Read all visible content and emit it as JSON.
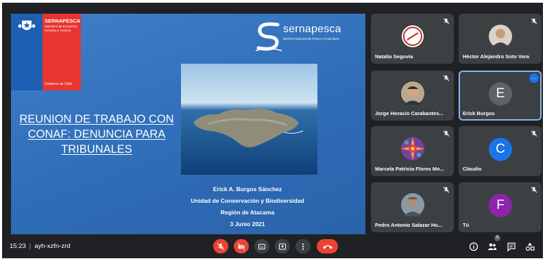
{
  "slide": {
    "gov_name": "SERNAPESCA",
    "gov_ministry": "Ministerio de Economía, Fomento y Turismo",
    "gov_footer": "Gobierno de Chile",
    "logo_name": "sernapesca",
    "logo_sub": "Servicio Nacional de Pesca y Acuicultura",
    "title": "REUNION DE TRABAJO CON CONAF: DENUNCIA PARA TRIBUNALES",
    "credit_lines": [
      "Erick A. Burgos Sánchez",
      "Unidad de Conservación  y Biodiversidad",
      "Región de Atacama",
      "3 Junio  2021"
    ]
  },
  "participants": [
    {
      "name": "Natalia Segovia",
      "avatar": "logo-avatar",
      "muted": true
    },
    {
      "name": "Héctor Alejandro Soto Vera",
      "avatar": "photo-avatar",
      "muted": true
    },
    {
      "name": "Jorge Horacio Carabantes...",
      "avatar": "photo-avatar",
      "muted": true
    },
    {
      "name": "Erick Burgos",
      "avatar": "E",
      "avatar_color": "#5f6368",
      "muted": false,
      "active": true
    },
    {
      "name": "Marcela Patricia Flores Mo...",
      "avatar": "pattern-avatar",
      "muted": true
    },
    {
      "name": "Claudio",
      "avatar": "C",
      "avatar_color": "#1a73e8",
      "muted": true
    },
    {
      "name": "Pedro Antonio Salazar Hu...",
      "avatar": "photo-avatar",
      "muted": true
    },
    {
      "name": "Tú",
      "avatar": "F",
      "avatar_color": "#8e24aa",
      "muted": true
    }
  ],
  "bottom_bar": {
    "time": "15:23",
    "meeting_code": "ayh-xzfn-zrd",
    "participants_badge": "9",
    "controls": [
      "mic-off-icon",
      "camera-off-icon",
      "captions-icon",
      "present-icon",
      "more-options-icon",
      "end-call-icon"
    ],
    "right_icons": [
      "info-icon",
      "people-icon",
      "chat-icon",
      "activities-icon"
    ]
  },
  "colors": {
    "background": "#202124",
    "tile": "#3c4043",
    "danger": "#ea4335",
    "accent": "#8ab4f8"
  }
}
